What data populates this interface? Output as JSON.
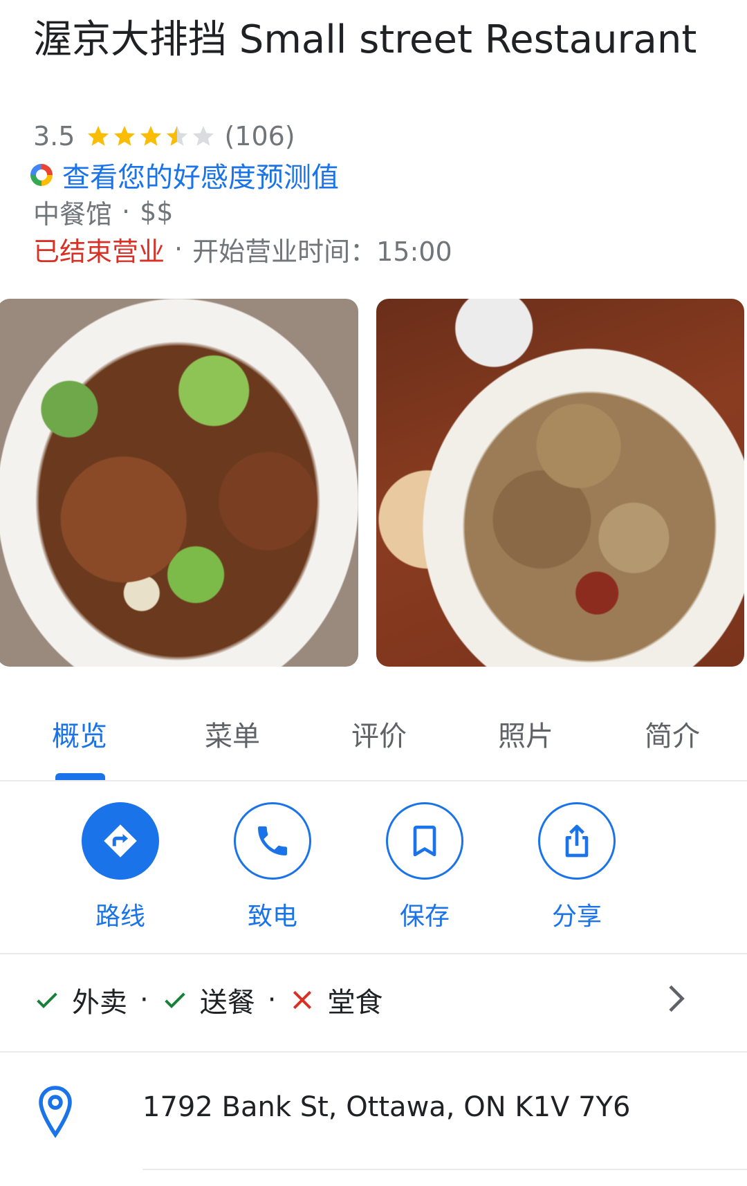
{
  "place": {
    "title": "渥京大排挡 Small street Restaurant",
    "rating": "3.5",
    "rating_value": 3.5,
    "review_count": "(106)",
    "prediction_link": "查看您的好感度预测值",
    "category": "中餐馆",
    "category_sep": "·",
    "price": "$$",
    "status": "已结束营业",
    "status_sep": "·",
    "open_info": "开始营业时间：15:00"
  },
  "tabs": [
    {
      "label": "概览",
      "active": true
    },
    {
      "label": "菜单"
    },
    {
      "label": "评价"
    },
    {
      "label": "照片"
    },
    {
      "label": "简介"
    }
  ],
  "actions": [
    {
      "label": "路线",
      "icon": "directions-icon"
    },
    {
      "label": "致电",
      "icon": "phone-icon"
    },
    {
      "label": "保存",
      "icon": "bookmark-icon"
    },
    {
      "label": "分享",
      "icon": "share-icon"
    }
  ],
  "services": [
    {
      "label": "外卖",
      "available": true
    },
    {
      "label": "送餐",
      "available": true
    },
    {
      "label": "堂食",
      "available": false
    }
  ],
  "services_sep": "·",
  "address": "1792 Bank St, Ottawa, ON K1V 7Y6",
  "colors": {
    "accent": "#1a73e8",
    "closed": "#d93025",
    "check": "#188038",
    "cross": "#d93025",
    "star": "#fbbc04",
    "secondary_text": "#70757a"
  }
}
